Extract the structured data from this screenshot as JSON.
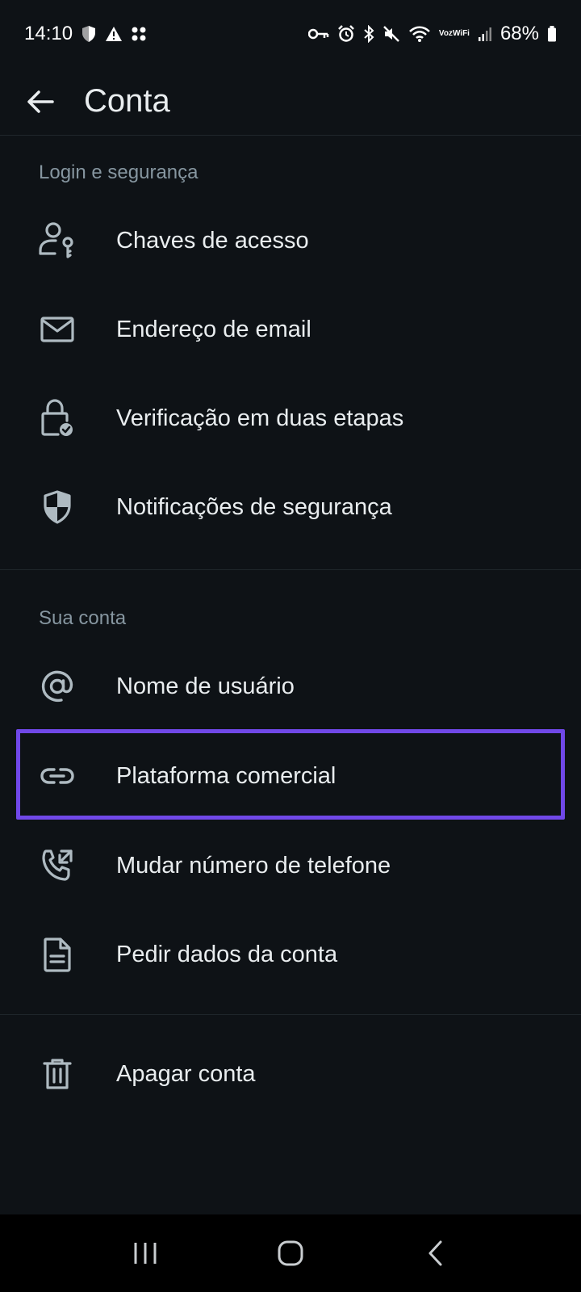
{
  "status_bar": {
    "time": "14:10",
    "battery": "68%",
    "voz_top": "Voz",
    "voz_bottom": "WiFi"
  },
  "header": {
    "title": "Conta"
  },
  "sections": [
    {
      "title": "Login e segurança",
      "items": [
        {
          "label": "Chaves de acesso",
          "icon": "passkey-icon"
        },
        {
          "label": "Endereço de email",
          "icon": "email-icon"
        },
        {
          "label": "Verificação em duas etapas",
          "icon": "lock-check-icon"
        },
        {
          "label": "Notificações de segurança",
          "icon": "shield-icon"
        }
      ]
    },
    {
      "title": "Sua conta",
      "items": [
        {
          "label": "Nome de usuário",
          "icon": "at-icon"
        },
        {
          "label": "Plataforma comercial",
          "icon": "link-icon"
        },
        {
          "label": "Mudar número de telefone",
          "icon": "phone-swap-icon"
        },
        {
          "label": "Pedir dados da conta",
          "icon": "document-icon"
        }
      ]
    },
    {
      "title": "",
      "items": [
        {
          "label": "Apagar conta",
          "icon": "trash-icon"
        }
      ]
    }
  ],
  "colors": {
    "background": "#0e1216",
    "text": "#e9edef",
    "secondary_text": "#8696a0",
    "highlight": "#7048e8"
  }
}
